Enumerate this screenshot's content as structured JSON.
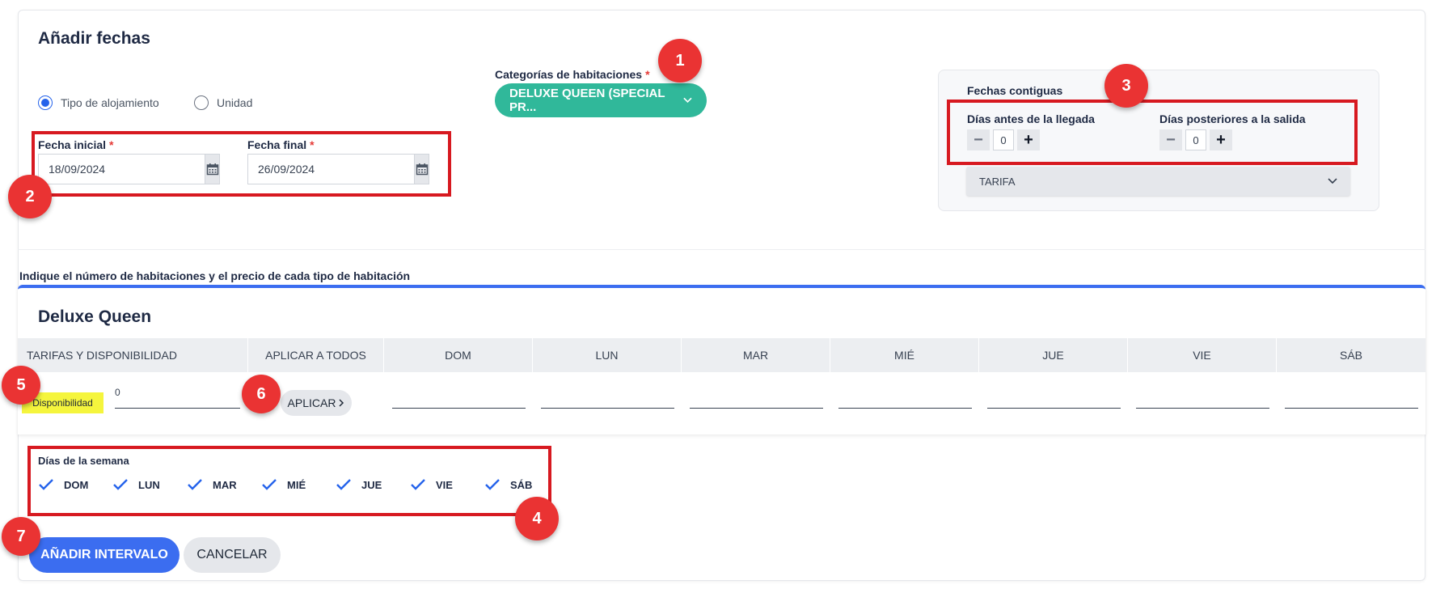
{
  "form": {
    "title": "Añadir fechas",
    "radios": [
      {
        "label": "Tipo de alojamiento",
        "checked": true
      },
      {
        "label": "Unidad",
        "checked": false
      }
    ],
    "start_date": {
      "label": "Fecha inicial",
      "value": "18/09/2024"
    },
    "end_date": {
      "label": "Fecha final",
      "value": "26/09/2024"
    },
    "required_mark": "*"
  },
  "room_categories": {
    "label": "Categorías de habitaciones",
    "selected": "DELUXE QUEEN (SPECIAL PR..."
  },
  "contiguous": {
    "title": "Fechas contiguas",
    "before_label": "Días antes de la llegada",
    "before_value": "0",
    "after_label": "Días posteriores a la salida",
    "after_value": "0",
    "rate_select": "TARIFA"
  },
  "hint": "Indique el número de habitaciones y el precio de cada tipo de habitación",
  "room_type": {
    "title": "Deluxe Queen",
    "headers": [
      "TARIFAS Y DISPONIBILIDAD",
      "APLICAR A TODOS",
      "DOM",
      "LUN",
      "MAR",
      "MIÉ",
      "JUE",
      "VIE",
      "SÁB"
    ],
    "availability_label": "Disponibilidad",
    "availability_value": "0",
    "apply_label": "APLICAR"
  },
  "weekdays": {
    "title": "Días de la semana",
    "days": [
      "DOM",
      "LUN",
      "MAR",
      "MIÉ",
      "JUE",
      "VIE",
      "SÁB"
    ]
  },
  "actions": {
    "add_interval": "AÑADIR INTERVALO",
    "cancel": "CANCELAR"
  },
  "badges": [
    "1",
    "2",
    "3",
    "4",
    "5",
    "6",
    "7"
  ],
  "colors": {
    "annotation_red": "#d71920",
    "badge_red": "#ea3333",
    "primary_blue": "#3b6df0",
    "category_green": "#30b89a",
    "highlight_yellow": "#f5f53d"
  }
}
